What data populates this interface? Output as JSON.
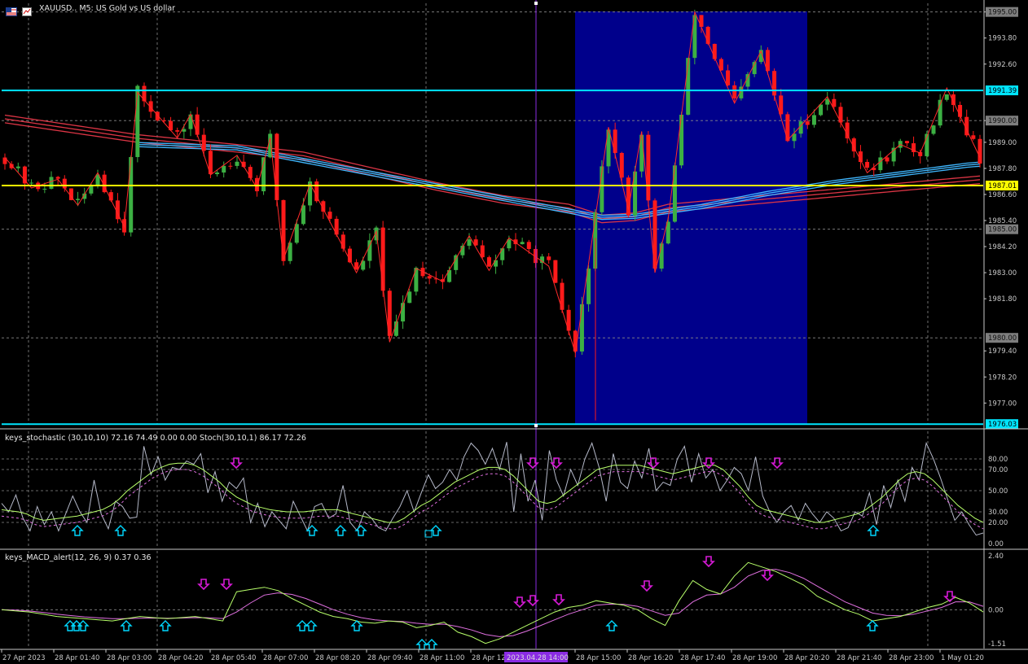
{
  "window": {
    "title": "XAUUSD.. M5:  US Gold vs US dollar",
    "icons": [
      "flag-icon",
      "chart-icon"
    ]
  },
  "colors": {
    "background": "#000000",
    "bull": "#3cb043",
    "bear": "#ff1a1a",
    "ma_red": "#dc3545",
    "ma_blue": "#3fb7ff",
    "zigzag": "#ff2a2a",
    "highlight": "#00008b",
    "level_cyan": "#00e5ff",
    "level_yellow": "#ffff00",
    "arrow_up": "#00d8ff",
    "arrow_down": "#d61ad6",
    "stoch_main": "#b4b8c8",
    "stoch_signal": "#b8ff6a",
    "stoch_dash": "#e070e0",
    "vline": "#8a2be2"
  },
  "chart_data": [
    {
      "type": "candlestick",
      "title": "XAUUSD.. M5:  US Gold vs US dollar",
      "ylim": [
        1976.0,
        1995.4
      ],
      "price_ticks": [
        "1995.00",
        "1993.80",
        "1992.60",
        "1990.00",
        "1989.00",
        "1987.80",
        "1986.60",
        "1985.40",
        "1984.20",
        "1983.00",
        "1981.80",
        "1979.40",
        "1978.20",
        "1977.00"
      ],
      "horizontal_levels": [
        {
          "value": 1991.39,
          "label": "1991.39",
          "color": "cyan"
        },
        {
          "value": 1987.01,
          "label": "1987.01",
          "color": "yellow"
        },
        {
          "value": 1976.03,
          "label": "1976.03",
          "color": "cyan"
        }
      ],
      "grid_levels": [
        {
          "value": 1995.0,
          "label": "1995.00"
        },
        {
          "value": 1990.0,
          "label": "1990.00"
        },
        {
          "value": 1985.0,
          "label": "1985.00"
        },
        {
          "value": 1980.0,
          "label": "1980.00"
        }
      ],
      "highlight_range_time": [
        "28 Apr 15:00",
        "28 Apr 20:00"
      ],
      "zigzag": [
        [
          0,
          1988.3
        ],
        [
          4,
          1986.9
        ],
        [
          8,
          1987.3
        ],
        [
          11,
          1986.1
        ],
        [
          14,
          1987.6
        ],
        [
          18,
          1985.1
        ],
        [
          20,
          1991.3
        ],
        [
          26,
          1989.2
        ],
        [
          28,
          1990.3
        ],
        [
          31,
          1987.5
        ],
        [
          35,
          1988.4
        ],
        [
          38,
          1986.9
        ],
        [
          40,
          1989.2
        ],
        [
          42,
          1983.6
        ],
        [
          46,
          1987.1
        ],
        [
          53,
          1983.0
        ],
        [
          56,
          1984.9
        ],
        [
          58,
          1979.8
        ],
        [
          62,
          1983.2
        ],
        [
          66,
          1982.6
        ],
        [
          70,
          1984.7
        ],
        [
          73,
          1983.1
        ],
        [
          76,
          1984.6
        ],
        [
          82,
          1983.3
        ],
        [
          86,
          1979.3
        ],
        [
          89,
          1985.5
        ],
        [
          91,
          1989.7
        ],
        [
          94,
          1985.9
        ],
        [
          96,
          1989.5
        ],
        [
          98,
          1983.0
        ],
        [
          100,
          1985.5
        ],
        [
          104,
          1995.0
        ],
        [
          110,
          1990.8
        ],
        [
          114,
          1993.2
        ],
        [
          118,
          1989.1
        ],
        [
          124,
          1991.1
        ],
        [
          130,
          1987.6
        ],
        [
          135,
          1988.9
        ],
        [
          138,
          1988.5
        ],
        [
          142,
          1991.5
        ],
        [
          147,
          1988.3
        ]
      ],
      "ma_red_bands": [
        [
          0,
          1989.9
        ],
        [
          20,
          1989.0
        ],
        [
          35,
          1988.55
        ],
        [
          45,
          1988.2
        ],
        [
          55,
          1987.5
        ],
        [
          65,
          1986.8
        ],
        [
          75,
          1986.2
        ],
        [
          85,
          1985.8
        ],
        [
          90,
          1985.3
        ],
        [
          95,
          1985.4
        ],
        [
          100,
          1985.8
        ],
        [
          147,
          1987.1
        ]
      ],
      "ma_blue_bands": [
        [
          20,
          1988.85
        ],
        [
          35,
          1988.7
        ],
        [
          90,
          1985.5
        ],
        [
          95,
          1985.55
        ],
        [
          105,
          1986.0
        ],
        [
          115,
          1986.6
        ],
        [
          125,
          1987.1
        ],
        [
          135,
          1987.5
        ],
        [
          145,
          1987.9
        ],
        [
          147,
          1987.95
        ]
      ],
      "candles_count": 148
    },
    {
      "type": "line",
      "title": "keys_stochastic (30,10,10) 72.16 74.49 0.00 0.00 Stoch(30,10,1) 86.17 72.26",
      "ylim": [
        0,
        100
      ],
      "y_ticks": [
        "80.00",
        "70.00",
        "50.00",
        "30.00",
        "20.00",
        "0.00"
      ],
      "levels": [
        80,
        70,
        50,
        30,
        20
      ],
      "series": [
        {
          "key": "fast",
          "values": [
            38,
            30,
            46,
            24,
            12,
            35,
            18,
            30,
            12,
            28,
            45,
            30,
            20,
            60,
            28,
            14,
            40,
            35,
            24,
            25,
            92,
            65,
            82,
            60,
            72,
            70,
            78,
            75,
            85,
            48,
            68,
            40,
            58,
            52,
            62,
            20,
            38,
            16,
            30,
            22,
            14,
            40,
            26,
            12,
            35,
            38,
            24,
            28,
            55,
            20,
            12,
            30,
            24,
            15,
            12,
            24,
            35,
            50,
            30,
            48,
            65,
            52,
            58,
            70,
            60,
            82,
            95,
            88,
            75,
            90,
            70,
            96,
            30,
            85,
            40,
            60,
            22,
            88,
            60,
            45,
            70,
            55,
            80,
            95,
            72,
            40,
            85,
            58,
            52,
            78,
            62,
            90,
            50,
            58,
            55,
            80,
            92,
            58,
            85,
            62,
            70,
            50,
            60,
            72,
            66,
            50,
            82,
            45,
            30,
            20,
            30,
            36,
            22,
            38,
            28,
            20,
            30,
            24,
            12,
            15,
            30,
            26,
            48,
            18,
            55,
            34,
            60,
            40,
            72,
            60,
            95,
            80,
            62,
            42,
            22,
            30,
            18,
            8,
            10
          ]
        },
        {
          "key": "signal",
          "values": [
            32,
            31,
            30,
            28,
            24,
            22,
            23,
            24,
            25,
            26,
            28,
            30,
            32,
            36,
            42,
            50,
            56,
            62,
            68,
            72,
            75,
            76,
            76,
            74,
            70,
            64,
            58,
            50,
            44,
            40,
            36,
            34,
            32,
            31,
            30,
            30,
            30,
            31,
            32,
            32,
            32,
            30,
            28,
            26,
            24,
            22,
            20,
            20,
            24,
            30,
            36,
            40,
            46,
            52,
            58,
            62,
            66,
            70,
            72,
            72,
            70,
            64,
            56,
            48,
            40,
            38,
            40,
            46,
            52,
            58,
            64,
            70,
            72,
            74,
            74,
            74,
            74,
            72,
            70,
            68,
            66,
            68,
            70,
            72,
            74,
            74,
            70,
            62,
            54,
            44,
            36,
            32,
            30,
            28,
            26,
            24,
            22,
            20,
            20,
            22,
            24,
            26,
            28,
            32,
            38,
            44,
            52,
            60,
            66,
            68,
            66,
            60,
            52,
            44,
            36,
            30,
            24,
            20
          ]
        }
      ],
      "arrows_up_index": [
        10,
        19,
        50,
        52,
        60,
        65,
        75,
        150
      ],
      "arrows_down_index": [
        32,
        83,
        87,
        103,
        111,
        122
      ]
    },
    {
      "type": "line",
      "title": "keys_MACD_alert(12, 26, 9) 0.37 0.36",
      "ylim": [
        -1.51,
        2.4
      ],
      "y_ticks": [
        "2.40",
        "0.00",
        "-1.51"
      ],
      "series": [
        {
          "key": "macd",
          "values": [
            0,
            -0.05,
            -0.1,
            -0.2,
            -0.3,
            -0.35,
            -0.4,
            -0.45,
            -0.5,
            -0.4,
            -0.3,
            -0.35,
            -0.4,
            -0.35,
            -0.3,
            -0.4,
            -0.5,
            0.8,
            0.9,
            1.0,
            0.85,
            0.5,
            0.2,
            -0.1,
            -0.3,
            -0.4,
            -0.55,
            -0.6,
            -0.5,
            -0.55,
            -0.8,
            -0.7,
            -0.55,
            -1.0,
            -1.2,
            -1.5,
            -1.3,
            -1.0,
            -0.7,
            -0.4,
            -0.1,
            0.1,
            0.2,
            0.4,
            0.3,
            0.2,
            0.0,
            -0.4,
            -0.7,
            0.4,
            1.3,
            0.9,
            0.7,
            1.5,
            2.1,
            1.9,
            1.7,
            1.4,
            1.1,
            0.6,
            0.3,
            0.0,
            -0.2,
            -0.5,
            -0.4,
            -0.3,
            -0.1,
            0.1,
            0.25,
            0.55,
            0.3,
            -0.1
          ]
        },
        {
          "key": "signal",
          "values": [
            0,
            -0.02,
            -0.06,
            -0.12,
            -0.2,
            -0.26,
            -0.32,
            -0.36,
            -0.4,
            -0.4,
            -0.38,
            -0.37,
            -0.38,
            -0.37,
            -0.35,
            -0.36,
            -0.39,
            -0.1,
            0.3,
            0.65,
            0.75,
            0.68,
            0.5,
            0.25,
            0.0,
            -0.2,
            -0.35,
            -0.45,
            -0.5,
            -0.52,
            -0.6,
            -0.65,
            -0.64,
            -0.75,
            -0.9,
            -1.1,
            -1.2,
            -1.15,
            -0.95,
            -0.7,
            -0.45,
            -0.2,
            0.0,
            0.2,
            0.25,
            0.24,
            0.15,
            -0.05,
            -0.25,
            -0.15,
            0.35,
            0.65,
            0.7,
            1.0,
            1.5,
            1.75,
            1.8,
            1.65,
            1.4,
            1.05,
            0.7,
            0.35,
            0.1,
            -0.15,
            -0.25,
            -0.27,
            -0.2,
            -0.05,
            0.1,
            0.35,
            0.35,
            0.15
          ]
        }
      ],
      "arrows_up_index": [
        5,
        6,
        7,
        10,
        13,
        23,
        25,
        29,
        34,
        35,
        52,
        68
      ],
      "arrows_down_index": [
        16,
        18,
        43,
        44,
        47,
        56,
        61,
        66,
        79
      ]
    }
  ],
  "time_axis": {
    "labels": [
      "27 Apr 2023",
      "28 Apr 01:40",
      "28 Apr 03:00",
      "28 Apr 04:20",
      "28 Apr 05:40",
      "28 Apr 07:00",
      "28 Apr 08:20",
      "28 Apr 09:40",
      "28 Apr 11:00",
      "28 Apr 12:",
      "28 Apr 15:00",
      "28 Apr 16:20",
      "28 Apr 17:40",
      "28 Apr 19:00",
      "28 Apr 20:20",
      "28 Apr 21:40",
      "28 Apr 23:00",
      "1 May 01:20"
    ],
    "cursor_label": "2023.04.28 14:00"
  }
}
